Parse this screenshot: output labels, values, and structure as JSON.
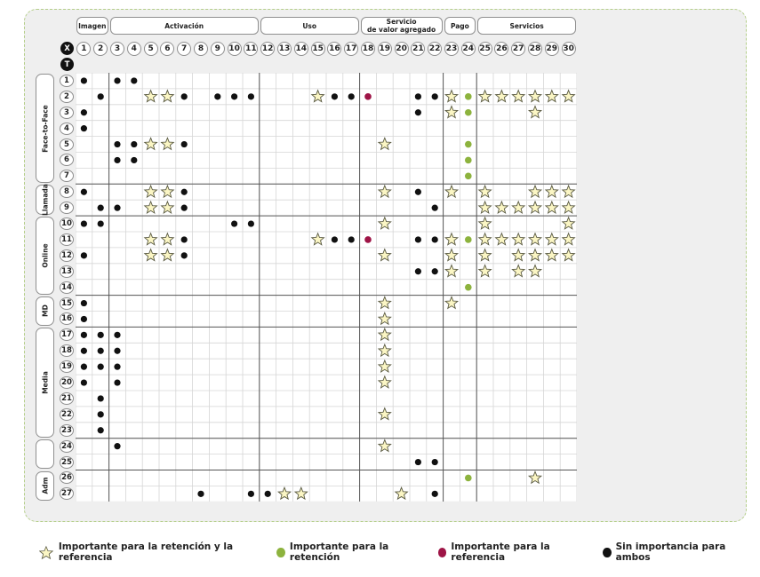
{
  "header": {
    "groups": [
      {
        "label": "Imagen",
        "from": 1,
        "to": 2
      },
      {
        "label": "Activación",
        "from": 3,
        "to": 11
      },
      {
        "label": "Uso",
        "from": 12,
        "to": 17
      },
      {
        "label": "Servicio\nde valor agregado",
        "from": 18,
        "to": 22
      },
      {
        "label": "Pago",
        "from": 23,
        "to": 24
      },
      {
        "label": "Servicios",
        "from": 25,
        "to": 30
      }
    ],
    "x_label": "X",
    "t_label": "T",
    "columns": [
      "1",
      "2",
      "3",
      "4",
      "5",
      "6",
      "7",
      "8",
      "9",
      "10",
      "11",
      "12",
      "13",
      "14",
      "15",
      "16",
      "17",
      "18",
      "19",
      "20",
      "21",
      "22",
      "23",
      "24",
      "25",
      "26",
      "27",
      "28",
      "29",
      "30"
    ]
  },
  "rows": [
    "1",
    "2",
    "3",
    "4",
    "5",
    "6",
    "7",
    "8",
    "9",
    "10",
    "11",
    "12",
    "13",
    "14",
    "15",
    "16",
    "17",
    "18",
    "19",
    "20",
    "21",
    "22",
    "23",
    "24",
    "25",
    "26",
    "27"
  ],
  "side_groups": [
    {
      "label": "Face-to-Face",
      "from": 1,
      "to": 7
    },
    {
      "label": "Llamada",
      "from": 8,
      "to": 9
    },
    {
      "label": "Online",
      "from": 10,
      "to": 14
    },
    {
      "label": "MD",
      "from": 15,
      "to": 16
    },
    {
      "label": "Media",
      "from": 17,
      "to": 23
    },
    {
      "label": "",
      "from": 24,
      "to": 25
    },
    {
      "label": "Adm",
      "from": 26,
      "to": 27
    }
  ],
  "col_separators_after": [
    2,
    11,
    17,
    22,
    24
  ],
  "row_separators_after": [
    7,
    9,
    14,
    16,
    23,
    25
  ],
  "colors": {
    "star_fill": "#fbf6c4",
    "star_stroke": "#5a5a42",
    "green": "#8db33e",
    "crimson": "#9e1446",
    "black": "#111111",
    "grid": "#d6d6d6",
    "separator": "#555555"
  },
  "chart_data": {
    "type": "table",
    "cells": [
      {
        "row": 1,
        "col": 1,
        "mark": "black"
      },
      {
        "row": 1,
        "col": 3,
        "mark": "black"
      },
      {
        "row": 1,
        "col": 4,
        "mark": "black"
      },
      {
        "row": 2,
        "col": 2,
        "mark": "black"
      },
      {
        "row": 2,
        "col": 5,
        "mark": "star"
      },
      {
        "row": 2,
        "col": 6,
        "mark": "star"
      },
      {
        "row": 2,
        "col": 7,
        "mark": "black"
      },
      {
        "row": 2,
        "col": 9,
        "mark": "black"
      },
      {
        "row": 2,
        "col": 10,
        "mark": "black"
      },
      {
        "row": 2,
        "col": 11,
        "mark": "black"
      },
      {
        "row": 2,
        "col": 15,
        "mark": "star"
      },
      {
        "row": 2,
        "col": 16,
        "mark": "black"
      },
      {
        "row": 2,
        "col": 17,
        "mark": "black"
      },
      {
        "row": 2,
        "col": 18,
        "mark": "crimson"
      },
      {
        "row": 2,
        "col": 21,
        "mark": "black"
      },
      {
        "row": 2,
        "col": 22,
        "mark": "black"
      },
      {
        "row": 2,
        "col": 23,
        "mark": "star"
      },
      {
        "row": 2,
        "col": 24,
        "mark": "green"
      },
      {
        "row": 2,
        "col": 25,
        "mark": "star"
      },
      {
        "row": 2,
        "col": 26,
        "mark": "star"
      },
      {
        "row": 2,
        "col": 27,
        "mark": "star"
      },
      {
        "row": 2,
        "col": 28,
        "mark": "star"
      },
      {
        "row": 2,
        "col": 29,
        "mark": "star"
      },
      {
        "row": 2,
        "col": 30,
        "mark": "star"
      },
      {
        "row": 3,
        "col": 1,
        "mark": "black"
      },
      {
        "row": 3,
        "col": 21,
        "mark": "black"
      },
      {
        "row": 3,
        "col": 23,
        "mark": "star"
      },
      {
        "row": 3,
        "col": 24,
        "mark": "green"
      },
      {
        "row": 3,
        "col": 28,
        "mark": "star"
      },
      {
        "row": 4,
        "col": 1,
        "mark": "black"
      },
      {
        "row": 5,
        "col": 3,
        "mark": "black"
      },
      {
        "row": 5,
        "col": 4,
        "mark": "black"
      },
      {
        "row": 5,
        "col": 5,
        "mark": "star"
      },
      {
        "row": 5,
        "col": 6,
        "mark": "star"
      },
      {
        "row": 5,
        "col": 7,
        "mark": "black"
      },
      {
        "row": 5,
        "col": 19,
        "mark": "star"
      },
      {
        "row": 5,
        "col": 24,
        "mark": "green"
      },
      {
        "row": 6,
        "col": 3,
        "mark": "black"
      },
      {
        "row": 6,
        "col": 4,
        "mark": "black"
      },
      {
        "row": 6,
        "col": 24,
        "mark": "green"
      },
      {
        "row": 7,
        "col": 24,
        "mark": "green"
      },
      {
        "row": 8,
        "col": 1,
        "mark": "black"
      },
      {
        "row": 8,
        "col": 5,
        "mark": "star"
      },
      {
        "row": 8,
        "col": 6,
        "mark": "star"
      },
      {
        "row": 8,
        "col": 7,
        "mark": "black"
      },
      {
        "row": 8,
        "col": 19,
        "mark": "star"
      },
      {
        "row": 8,
        "col": 21,
        "mark": "black"
      },
      {
        "row": 8,
        "col": 23,
        "mark": "star"
      },
      {
        "row": 8,
        "col": 25,
        "mark": "star"
      },
      {
        "row": 8,
        "col": 28,
        "mark": "star"
      },
      {
        "row": 8,
        "col": 29,
        "mark": "star"
      },
      {
        "row": 8,
        "col": 30,
        "mark": "star"
      },
      {
        "row": 9,
        "col": 2,
        "mark": "black"
      },
      {
        "row": 9,
        "col": 3,
        "mark": "black"
      },
      {
        "row": 9,
        "col": 5,
        "mark": "star"
      },
      {
        "row": 9,
        "col": 6,
        "mark": "star"
      },
      {
        "row": 9,
        "col": 7,
        "mark": "black"
      },
      {
        "row": 9,
        "col": 22,
        "mark": "black"
      },
      {
        "row": 9,
        "col": 25,
        "mark": "star"
      },
      {
        "row": 9,
        "col": 26,
        "mark": "star"
      },
      {
        "row": 9,
        "col": 27,
        "mark": "star"
      },
      {
        "row": 9,
        "col": 28,
        "mark": "star"
      },
      {
        "row": 9,
        "col": 29,
        "mark": "star"
      },
      {
        "row": 9,
        "col": 30,
        "mark": "star"
      },
      {
        "row": 10,
        "col": 1,
        "mark": "black"
      },
      {
        "row": 10,
        "col": 2,
        "mark": "black"
      },
      {
        "row": 10,
        "col": 10,
        "mark": "black"
      },
      {
        "row": 10,
        "col": 11,
        "mark": "black"
      },
      {
        "row": 10,
        "col": 19,
        "mark": "star"
      },
      {
        "row": 10,
        "col": 25,
        "mark": "star"
      },
      {
        "row": 10,
        "col": 30,
        "mark": "star"
      },
      {
        "row": 11,
        "col": 5,
        "mark": "star"
      },
      {
        "row": 11,
        "col": 6,
        "mark": "star"
      },
      {
        "row": 11,
        "col": 7,
        "mark": "black"
      },
      {
        "row": 11,
        "col": 15,
        "mark": "star"
      },
      {
        "row": 11,
        "col": 16,
        "mark": "black"
      },
      {
        "row": 11,
        "col": 17,
        "mark": "black"
      },
      {
        "row": 11,
        "col": 18,
        "mark": "crimson"
      },
      {
        "row": 11,
        "col": 21,
        "mark": "black"
      },
      {
        "row": 11,
        "col": 22,
        "mark": "black"
      },
      {
        "row": 11,
        "col": 23,
        "mark": "star"
      },
      {
        "row": 11,
        "col": 24,
        "mark": "green"
      },
      {
        "row": 11,
        "col": 25,
        "mark": "star"
      },
      {
        "row": 11,
        "col": 26,
        "mark": "star"
      },
      {
        "row": 11,
        "col": 27,
        "mark": "star"
      },
      {
        "row": 11,
        "col": 28,
        "mark": "star"
      },
      {
        "row": 11,
        "col": 29,
        "mark": "star"
      },
      {
        "row": 11,
        "col": 30,
        "mark": "star"
      },
      {
        "row": 12,
        "col": 1,
        "mark": "black"
      },
      {
        "row": 12,
        "col": 5,
        "mark": "star"
      },
      {
        "row": 12,
        "col": 6,
        "mark": "star"
      },
      {
        "row": 12,
        "col": 7,
        "mark": "black"
      },
      {
        "row": 12,
        "col": 19,
        "mark": "star"
      },
      {
        "row": 12,
        "col": 23,
        "mark": "star"
      },
      {
        "row": 12,
        "col": 25,
        "mark": "star"
      },
      {
        "row": 12,
        "col": 27,
        "mark": "star"
      },
      {
        "row": 12,
        "col": 28,
        "mark": "star"
      },
      {
        "row": 12,
        "col": 29,
        "mark": "star"
      },
      {
        "row": 12,
        "col": 30,
        "mark": "star"
      },
      {
        "row": 13,
        "col": 21,
        "mark": "black"
      },
      {
        "row": 13,
        "col": 22,
        "mark": "black"
      },
      {
        "row": 13,
        "col": 23,
        "mark": "star"
      },
      {
        "row": 13,
        "col": 25,
        "mark": "star"
      },
      {
        "row": 13,
        "col": 27,
        "mark": "star"
      },
      {
        "row": 13,
        "col": 28,
        "mark": "star"
      },
      {
        "row": 14,
        "col": 24,
        "mark": "green"
      },
      {
        "row": 15,
        "col": 1,
        "mark": "black"
      },
      {
        "row": 15,
        "col": 19,
        "mark": "star"
      },
      {
        "row": 15,
        "col": 23,
        "mark": "star"
      },
      {
        "row": 16,
        "col": 1,
        "mark": "black"
      },
      {
        "row": 16,
        "col": 19,
        "mark": "star"
      },
      {
        "row": 17,
        "col": 1,
        "mark": "black"
      },
      {
        "row": 17,
        "col": 2,
        "mark": "black"
      },
      {
        "row": 17,
        "col": 3,
        "mark": "black"
      },
      {
        "row": 17,
        "col": 19,
        "mark": "star"
      },
      {
        "row": 18,
        "col": 1,
        "mark": "black"
      },
      {
        "row": 18,
        "col": 2,
        "mark": "black"
      },
      {
        "row": 18,
        "col": 3,
        "mark": "black"
      },
      {
        "row": 18,
        "col": 19,
        "mark": "star"
      },
      {
        "row": 19,
        "col": 1,
        "mark": "black"
      },
      {
        "row": 19,
        "col": 2,
        "mark": "black"
      },
      {
        "row": 19,
        "col": 3,
        "mark": "black"
      },
      {
        "row": 19,
        "col": 19,
        "mark": "star"
      },
      {
        "row": 20,
        "col": 1,
        "mark": "black"
      },
      {
        "row": 20,
        "col": 3,
        "mark": "black"
      },
      {
        "row": 20,
        "col": 19,
        "mark": "star"
      },
      {
        "row": 21,
        "col": 2,
        "mark": "black"
      },
      {
        "row": 22,
        "col": 2,
        "mark": "black"
      },
      {
        "row": 22,
        "col": 19,
        "mark": "star"
      },
      {
        "row": 23,
        "col": 2,
        "mark": "black"
      },
      {
        "row": 24,
        "col": 3,
        "mark": "black"
      },
      {
        "row": 24,
        "col": 19,
        "mark": "star"
      },
      {
        "row": 25,
        "col": 21,
        "mark": "black"
      },
      {
        "row": 25,
        "col": 22,
        "mark": "black"
      },
      {
        "row": 26,
        "col": 24,
        "mark": "green"
      },
      {
        "row": 26,
        "col": 28,
        "mark": "star"
      },
      {
        "row": 27,
        "col": 8,
        "mark": "black"
      },
      {
        "row": 27,
        "col": 11,
        "mark": "black"
      },
      {
        "row": 27,
        "col": 12,
        "mark": "black"
      },
      {
        "row": 27,
        "col": 13,
        "mark": "star"
      },
      {
        "row": 27,
        "col": 14,
        "mark": "star"
      },
      {
        "row": 27,
        "col": 20,
        "mark": "star"
      },
      {
        "row": 27,
        "col": 22,
        "mark": "black"
      }
    ]
  },
  "legend": {
    "star": "Importante para la retención y la referencia",
    "green": "Importante para la retención",
    "crimson": "Importante para la referencia",
    "black": "Sin importancia para ambos"
  }
}
